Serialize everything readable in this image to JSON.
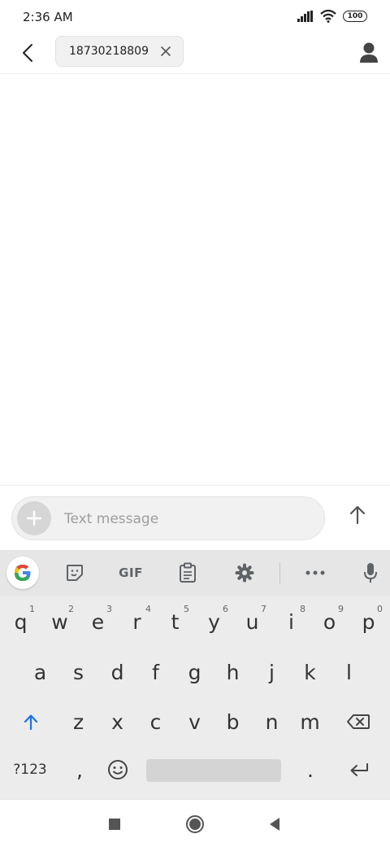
{
  "status_bar": {
    "time": "2:36 AM",
    "battery": "100"
  },
  "header": {
    "recipient": "18730218809"
  },
  "composer": {
    "placeholder": "Text message"
  },
  "keyboard": {
    "toolbar": {
      "gif_label": "GIF"
    },
    "row1": [
      {
        "label": "q",
        "hint": "1"
      },
      {
        "label": "w",
        "hint": "2"
      },
      {
        "label": "e",
        "hint": "3"
      },
      {
        "label": "r",
        "hint": "4"
      },
      {
        "label": "t",
        "hint": "5"
      },
      {
        "label": "y",
        "hint": "6"
      },
      {
        "label": "u",
        "hint": "7"
      },
      {
        "label": "i",
        "hint": "8"
      },
      {
        "label": "o",
        "hint": "9"
      },
      {
        "label": "p",
        "hint": "0"
      }
    ],
    "row2": [
      "a",
      "s",
      "d",
      "f",
      "g",
      "h",
      "j",
      "k",
      "l"
    ],
    "row3": [
      "z",
      "x",
      "c",
      "v",
      "b",
      "n",
      "m"
    ],
    "row4": {
      "symbols": "?123",
      "comma": ",",
      "period": "."
    }
  }
}
